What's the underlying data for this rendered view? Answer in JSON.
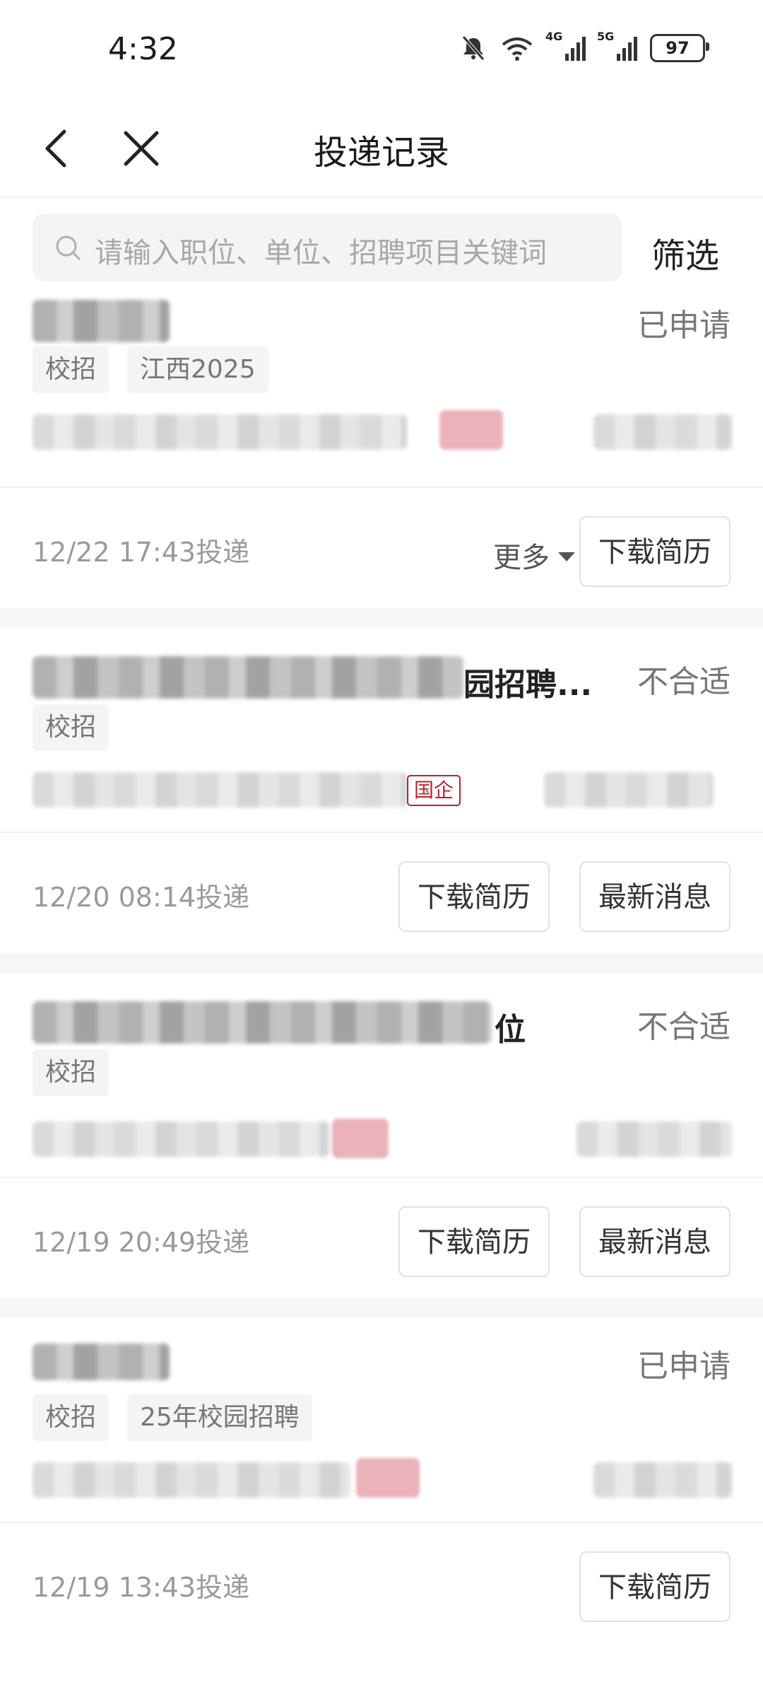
{
  "status_bar": {
    "time": "4:32",
    "net1": "4G",
    "net2": "5G",
    "battery": "97"
  },
  "nav": {
    "title": "投递记录"
  },
  "search": {
    "placeholder": "请输入职位、单位、招聘项目关键词",
    "filter_label": "筛选"
  },
  "records": [
    {
      "status": "已申请",
      "tags": [
        "校招",
        "江西2025"
      ],
      "date": "12/22 17:43投递",
      "more_label": "更多",
      "buttons": [
        "下载简历"
      ]
    },
    {
      "title_visible": "园招聘...",
      "status": "不合适",
      "tags": [
        "校招"
      ],
      "badge": "国企",
      "date": "12/20 08:14投递",
      "buttons": [
        "下载简历",
        "最新消息"
      ]
    },
    {
      "title_visible": "位",
      "status": "不合适",
      "tags": [
        "校招"
      ],
      "date": "12/19 20:49投递",
      "buttons": [
        "下载简历",
        "最新消息"
      ]
    },
    {
      "status": "已申请",
      "tags": [
        "校招",
        "25年校园招聘"
      ],
      "date": "12/19 13:43投递",
      "buttons": [
        "下载简历"
      ]
    }
  ]
}
